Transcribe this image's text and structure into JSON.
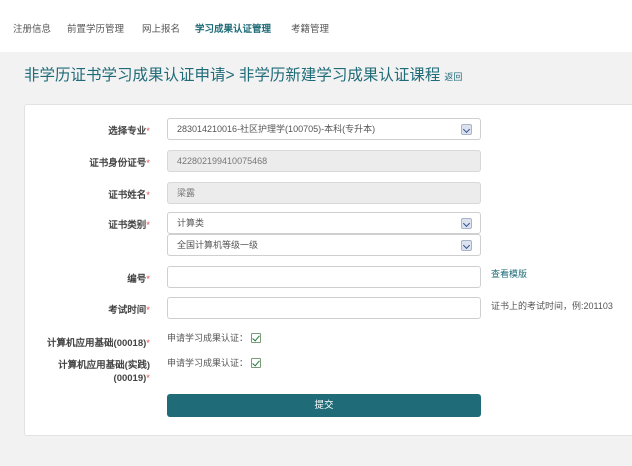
{
  "nav": {
    "items": [
      {
        "label": "注册信息"
      },
      {
        "label": "前置学历管理"
      },
      {
        "label": "网上报名"
      },
      {
        "label": "学习成果认证管理"
      },
      {
        "label": "考籍管理"
      }
    ]
  },
  "page": {
    "title": "非学历证书学习成果认证申请> 非学历新建学习成果认证课程",
    "back_label": "返回"
  },
  "form": {
    "major": {
      "label": "选择专业",
      "value": "283014210016-社区护理学(100705)-本科(专升本)"
    },
    "id_number": {
      "label": "证书身份证号",
      "value": "422802199410075468"
    },
    "cert_name": {
      "label": "证书姓名",
      "value": "梁露"
    },
    "cert_type": {
      "label": "证书类别",
      "value": "计算类",
      "sub_value": "全国计算机等级一级"
    },
    "number": {
      "label": "编号",
      "value": "",
      "link": "查看模版"
    },
    "exam_time": {
      "label": "考试时间",
      "value": "",
      "hint": "证书上的考试时间，例:201103"
    },
    "course1": {
      "label": "计算机应用基础(00018)",
      "check_label": "申请学习成果认证：",
      "checked": true
    },
    "course2": {
      "label": "计算机应用基础(实践)(00019)",
      "check_label": "申请学习成果认证：",
      "checked": true
    },
    "required_mark": "*",
    "submit_label": "提交"
  },
  "colors": {
    "accent": "#1f6b78",
    "required": "#d9534f"
  }
}
